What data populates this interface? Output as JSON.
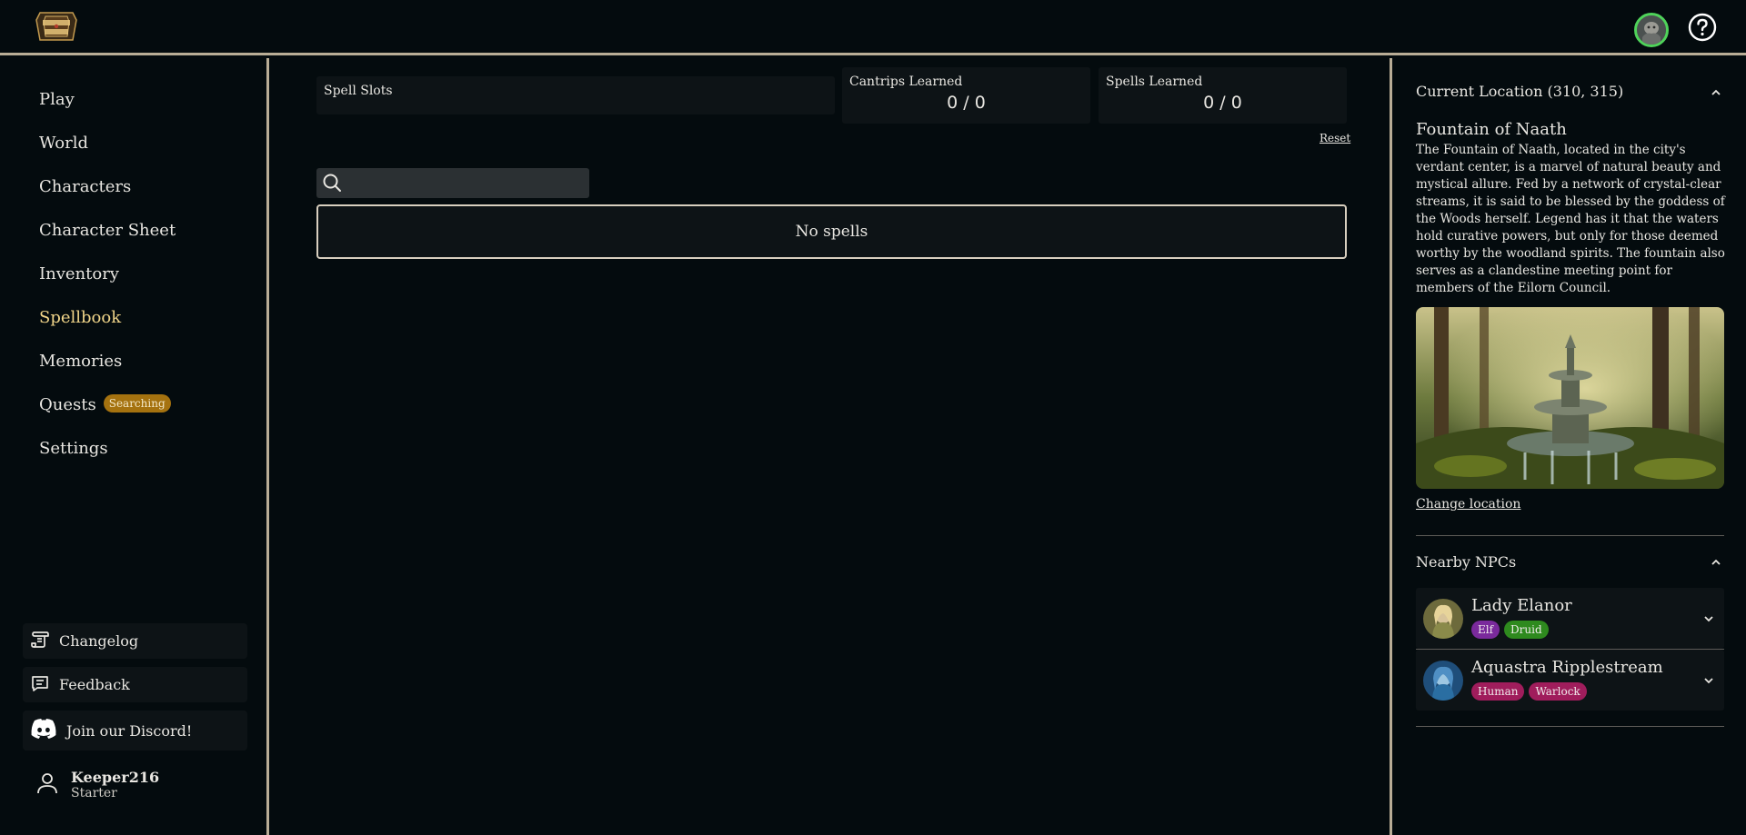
{
  "header": {
    "logo_alt": "Friends & Fables",
    "avatar_label": "User avatar",
    "help_label": "Help"
  },
  "sidebar": {
    "items": [
      {
        "label": "Play"
      },
      {
        "label": "World"
      },
      {
        "label": "Characters"
      },
      {
        "label": "Character Sheet"
      },
      {
        "label": "Inventory"
      },
      {
        "label": "Spellbook",
        "active": true
      },
      {
        "label": "Memories"
      },
      {
        "label": "Quests",
        "badge": "Searching"
      },
      {
        "label": "Settings"
      }
    ],
    "changelog_label": "Changelog",
    "feedback_label": "Feedback",
    "discord_label": "Join our Discord!",
    "user": {
      "name": "Keeper216",
      "plan": "Starter"
    }
  },
  "main": {
    "spell_slots_label": "Spell Slots",
    "cantrips": {
      "label": "Cantrips Learned",
      "value": "0 / 0"
    },
    "spells": {
      "label": "Spells Learned",
      "value": "0 / 0"
    },
    "reset_label": "Reset",
    "search": {
      "value": "",
      "placeholder": ""
    },
    "empty_text": "No spells"
  },
  "location": {
    "header": "Current Location (310, 315)",
    "name": "Fountain of Naath",
    "description": "The Fountain of Naath, located in the city's verdant center, is a marvel of natural beauty and mystical allure. Fed by a network of crystal-clear streams, it is said to be blessed by the goddess of the Woods herself. Legend has it that the waters hold curative powers, but only for those deemed worthy by the woodland spirits. The fountain also serves as a clandestine meeting point for members of the Eilorn Council.",
    "change_label": "Change location"
  },
  "npcs": {
    "header": "Nearby NPCs",
    "list": [
      {
        "name": "Lady Elanor",
        "tags": [
          "Elf",
          "Druid"
        ],
        "tag_colors": [
          "#7a2a9c",
          "#2e8a1e"
        ]
      },
      {
        "name": "Aquastra Ripplestream",
        "tags": [
          "Human",
          "Warlock"
        ],
        "tag_colors": [
          "#a01d5c",
          "#a01d5c"
        ]
      }
    ]
  },
  "colors": {
    "accent_gold": "#f2d68a",
    "badge_searching": "#a5720f",
    "border": "#b9ad96",
    "online_ring": "#4fd35a"
  }
}
